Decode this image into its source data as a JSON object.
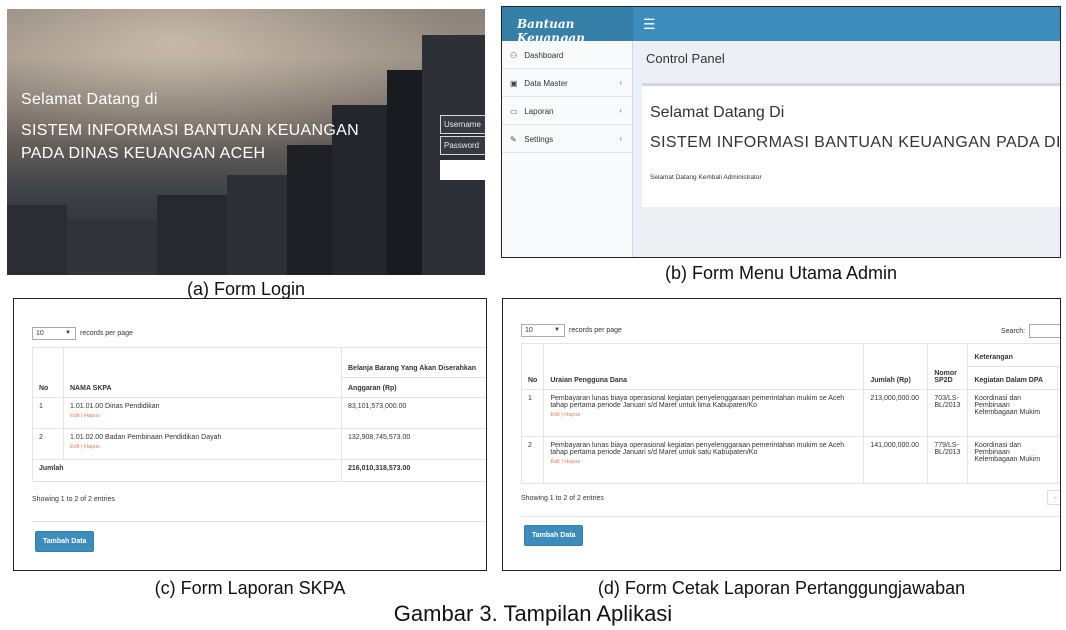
{
  "panel_a": {
    "welcome": "Selamat Datang di",
    "system_line1": "SISTEM INFORMASI BANTUAN KEUANGAN",
    "system_line2": "PADA DINAS KEUANGAN ACEH",
    "username_placeholder": "Username",
    "password_placeholder": "Password",
    "caption": "(a) Form Login"
  },
  "panel_b": {
    "brand": "Bantuan Keuangan",
    "sidebar": [
      {
        "label": "Dashboard",
        "icon": "dashboard-icon",
        "glyph": "⚇",
        "chevron": ""
      },
      {
        "label": "Data Master",
        "icon": "image-icon",
        "glyph": "▣",
        "chevron": "‹"
      },
      {
        "label": "Laporan",
        "icon": "laptop-icon",
        "glyph": "▭",
        "chevron": "‹"
      },
      {
        "label": "Settings",
        "icon": "wrench-icon",
        "glyph": "✎",
        "chevron": "‹"
      }
    ],
    "control_panel": "Control Panel",
    "heading1": "Selamat Datang Di",
    "heading2": "SISTEM INFORMASI BANTUAN KEUANGAN PADA DINAS K",
    "subtext": "Selamat Datang Kembali Administrator",
    "caption": "(b) Form Menu Utama Admin"
  },
  "panel_c": {
    "page_size": "10",
    "records_label": "records per page",
    "group_header": "Belanja Barang Yang Akan Diserahkan",
    "headers": {
      "no": "No",
      "name": "NAMA SKPA",
      "amount": "Anggaran (Rp)"
    },
    "rows": [
      {
        "no": "1",
        "name": "1.01.01.00 Dinas Pendidikan",
        "actions": "Edit | Hapus",
        "amount": "83,101,573,000.00"
      },
      {
        "no": "2",
        "name": "1.01.02.00 Badan Pembinaan Pendidikan Dayah",
        "actions": "Edit | Hapus",
        "amount": "132,908,745,573.00"
      }
    ],
    "total_label": "Jumlah",
    "total_value": "216,010,318,573.00",
    "showing": "Showing 1 to 2 of 2 entries",
    "add_button": "Tambah Data",
    "caption": "(c) Form Laporan SKPA"
  },
  "panel_d": {
    "page_size": "10",
    "records_label": "records per page",
    "search_label": "Search:",
    "headers": {
      "no": "No",
      "uraian": "Uraian Pengguna Dana",
      "jumlah": "Jumlah (Rp)",
      "nomor": "Nomor SP2D",
      "keterangan": "Keterangan",
      "kegiatan": "Kegiatan Dalam DPA",
      "extra": "R"
    },
    "rows": [
      {
        "no": "1",
        "uraian": "Pembayaran lunas biaya operasional kegiatan penyelenggaraan pemerintahan mukim se Aceh tahap pertama periode Januari s/d Maret untuk lima Kabupaten/Ko",
        "actions": "Edit | Hapus",
        "jumlah": "213,000,000.00",
        "nomor": "703/LS-BL/2013",
        "kegiatan": "Koordinasi dan Pembinaan Kelembagaan Mukim"
      },
      {
        "no": "2",
        "uraian": "Pembayaran lunas biaya operasional kegiatan penyelenggaraan pemerintahan mukim se Aceh tahap pertama periode Januari s/d Maret untuk satu Kabupaten/Ko",
        "actions": "Edit | Hapus",
        "jumlah": "141,000,000.00",
        "nomor": "779/LS-BL/2013",
        "kegiatan": "Koordinasi dan Pembinaan Kelembagaan Mukim"
      }
    ],
    "showing": "Showing 1 to 2 of 2 entries",
    "pager_prev": "←",
    "add_button": "Tambah Data",
    "caption": "(d) Form Cetak Laporan Pertanggungjawaban"
  },
  "figure_caption": "Gambar 3. Tampilan Aplikasi"
}
